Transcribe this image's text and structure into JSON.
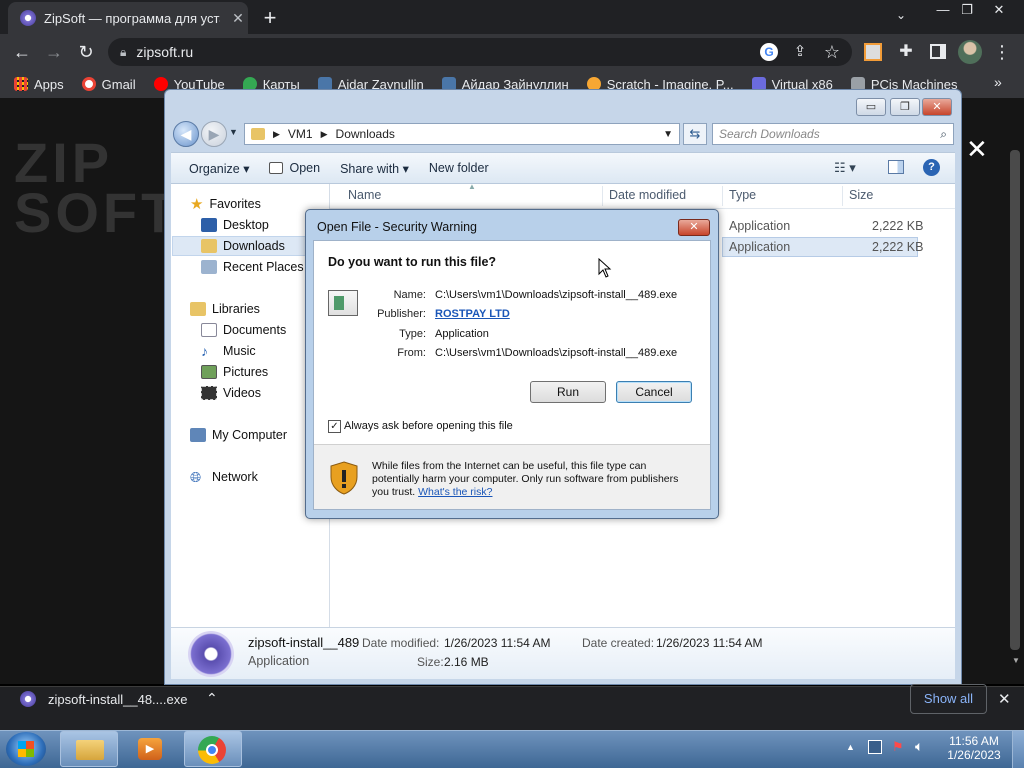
{
  "browser": {
    "tab_title": "ZipSoft — программа для устан",
    "tab_close": "✕",
    "new_tab": "+",
    "url": "zipsoft.ru",
    "window_controls": [
      "—",
      "❐",
      "✕"
    ]
  },
  "bookmarks": [
    {
      "label": "Apps",
      "color": "#e8eaed"
    },
    {
      "label": "Gmail",
      "color": "#ea4335"
    },
    {
      "label": "YouTube",
      "color": "#ff0000"
    },
    {
      "label": "Карты",
      "color": "#34a853"
    },
    {
      "label": "Aidar Zaynullin",
      "color": "#4a76a8"
    },
    {
      "label": "Айдар Зайнуллин",
      "color": "#4a76a8"
    },
    {
      "label": "Scratch - Imagine, P...",
      "color": "#f7a733"
    },
    {
      "label": "Virtual x86",
      "color": "#6b6bdd"
    },
    {
      "label": "PCjs Machines",
      "color": "#9aa0a6"
    }
  ],
  "page_logo": "ZIP\nSOFT",
  "page_close": "✕",
  "explorer": {
    "caption_buttons": [
      "▭",
      "❐",
      "✕"
    ],
    "breadcrumb": [
      "VM1",
      "Downloads"
    ],
    "search_placeholder": "Search Downloads",
    "commands": [
      "Organize ▾",
      "Open",
      "Share with ▾",
      "New folder"
    ],
    "nav": {
      "favorites": "Favorites",
      "desktop": "Desktop",
      "downloads": "Downloads",
      "recent": "Recent Places",
      "libraries": "Libraries",
      "documents": "Documents",
      "music": "Music",
      "pictures": "Pictures",
      "videos": "Videos",
      "computer": "My Computer",
      "network": "Network"
    },
    "columns": [
      "Name",
      "Date modified",
      "Type",
      "Size"
    ],
    "rows": [
      {
        "type": "Application",
        "size": "2,222 KB"
      },
      {
        "type": "Application",
        "size": "2,222 KB"
      }
    ],
    "details": {
      "filename": "zipsoft-install__489",
      "filetype": "Application",
      "modified_label": "Date modified:",
      "modified_value": "1/26/2023 11:54 AM",
      "created_label": "Date created:",
      "created_value": "1/26/2023 11:54 AM",
      "size_label": "Size:",
      "size_value": "2.16 MB"
    }
  },
  "dialog": {
    "title": "Open File - Security Warning",
    "close": "✕",
    "question": "Do you want to run this file?",
    "name_label": "Name:",
    "name_value": "C:\\Users\\vm1\\Downloads\\zipsoft-install__489.exe",
    "publisher_label": "Publisher:",
    "publisher_value": "ROSTPAY LTD",
    "type_label": "Type:",
    "type_value": "Application",
    "from_label": "From:",
    "from_value": "C:\\Users\\vm1\\Downloads\\zipsoft-install__489.exe",
    "run_button": "Run",
    "cancel_button": "Cancel",
    "checkbox_label": "Always ask before opening this file",
    "checkbox_checked": true,
    "warning_text": "While files from the Internet can be useful, this file type can potentially harm your computer. Only run software from publishers you trust.",
    "risk_link": "What's the risk?"
  },
  "download_bar": {
    "filename": "zipsoft-install__48....exe",
    "show_all": "Show all",
    "close": "✕"
  },
  "taskbar": {
    "time": "11:56 AM",
    "date": "1/26/2023"
  }
}
